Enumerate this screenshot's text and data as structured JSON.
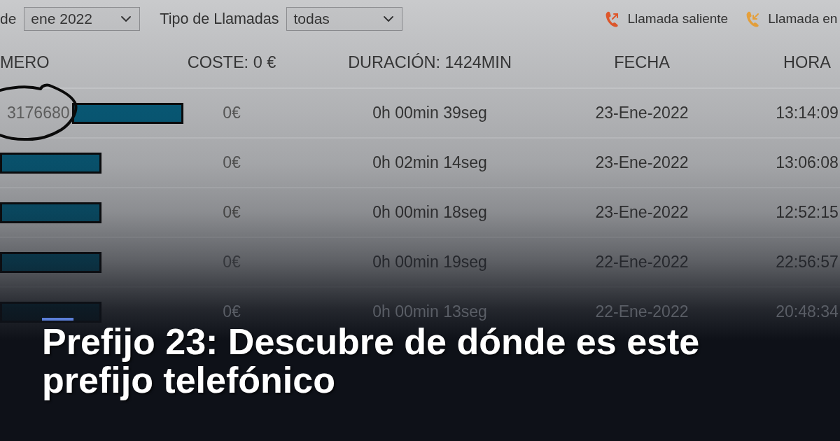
{
  "call_log": {
    "filters": [
      {
        "label": "de",
        "value": "ene 2022"
      },
      {
        "label": "Tipo de Llamadas",
        "value": "todas"
      }
    ],
    "legend": [
      {
        "kind": "outgoing",
        "label": "Llamada saliente",
        "color": "#e2582b"
      },
      {
        "kind": "incoming",
        "label": "Llamada en",
        "color": "#e9a23b"
      }
    ],
    "table": {
      "columns": [
        "MERO",
        "COSTE: 0 €",
        "DURACIÓN: 1424MIN",
        "FECHA",
        "HORA"
      ],
      "rows": [
        {
          "number": "3176680",
          "circled": true,
          "cost": "0€",
          "duration": "0h 00min 39seg",
          "date": "23-Ene-2022",
          "time": "13:14:09"
        },
        {
          "circled": false,
          "cost": "0€",
          "duration": "0h 02min 14seg",
          "date": "23-Ene-2022",
          "time": "13:06:08"
        },
        {
          "circled": false,
          "cost": "0€",
          "duration": "0h 00min 18seg",
          "date": "23-Ene-2022",
          "time": "12:52:15"
        },
        {
          "circled": false,
          "cost": "0€",
          "duration": "0h 00min 19seg",
          "date": "22-Ene-2022",
          "time": "22:56:57"
        },
        {
          "circled": false,
          "cost": "0€",
          "duration": "0h 00min 13seg",
          "date": "22-Ene-2022",
          "time": "20:48:34"
        }
      ]
    }
  },
  "article": {
    "title": "Prefijo 23: Descubre de dónde es este prefijo telefónico"
  }
}
